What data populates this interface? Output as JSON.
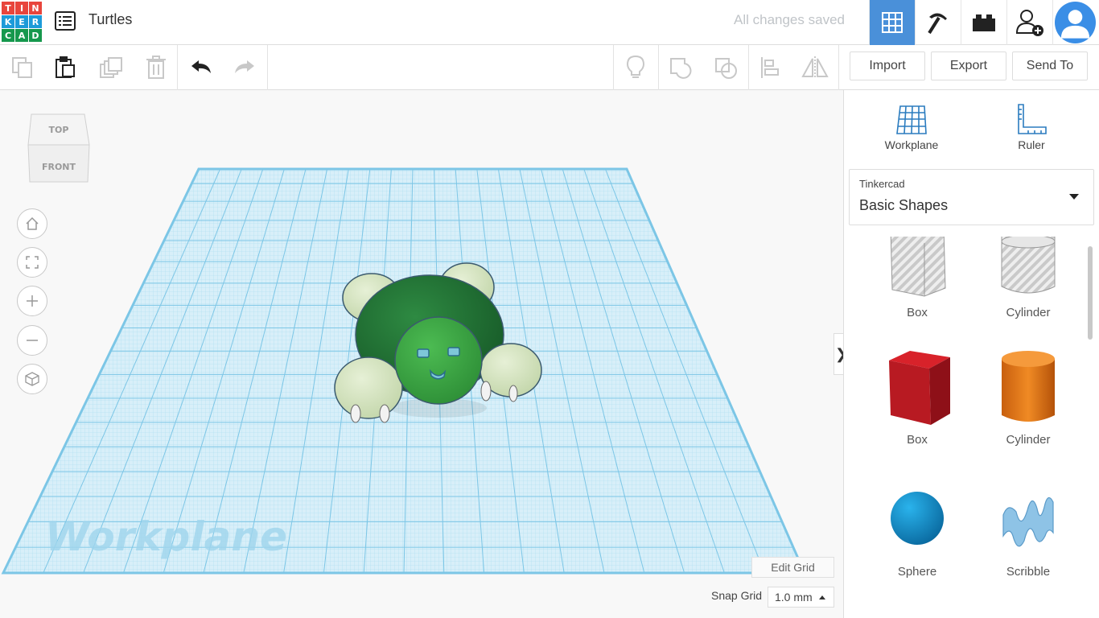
{
  "app": {
    "logo_letters": [
      "T",
      "I",
      "N",
      "K",
      "E",
      "R",
      "C",
      "A",
      "D"
    ],
    "logo_colors": [
      "#e8453c",
      "#e8453c",
      "#e8453c",
      "#1d9bd9",
      "#1d9bd9",
      "#1d9bd9",
      "#16984d",
      "#16984d",
      "#16984d"
    ],
    "project_title": "Turtles",
    "save_status": "All changes saved"
  },
  "top_icons": [
    "3d-design-grid-icon",
    "pickaxe-icon",
    "bricks-icon",
    "add-user-icon",
    "user-avatar"
  ],
  "toolbar": {
    "import_label": "Import",
    "export_label": "Export",
    "send_to_label": "Send To"
  },
  "viewcube": {
    "top": "TOP",
    "front": "FRONT"
  },
  "viewport": {
    "workplane_watermark": "Workplane",
    "edit_grid_label": "Edit Grid",
    "snap_grid_label": "Snap Grid",
    "snap_grid_value": "1.0 mm"
  },
  "panel": {
    "workplane_label": "Workplane",
    "ruler_label": "Ruler",
    "library_source": "Tinkercad",
    "library_name": "Basic Shapes",
    "shapes": [
      {
        "label": "Box"
      },
      {
        "label": "Cylinder"
      },
      {
        "label": "Box"
      },
      {
        "label": "Cylinder"
      },
      {
        "label": "Sphere"
      },
      {
        "label": "Scribble"
      }
    ]
  },
  "colors": {
    "accent": "#4a90d9",
    "workplane_grid": "#8fd0ec",
    "turtle_shell": "#1e6b33",
    "turtle_head": "#3aa445",
    "turtle_limbs": "#d6e6c0"
  }
}
